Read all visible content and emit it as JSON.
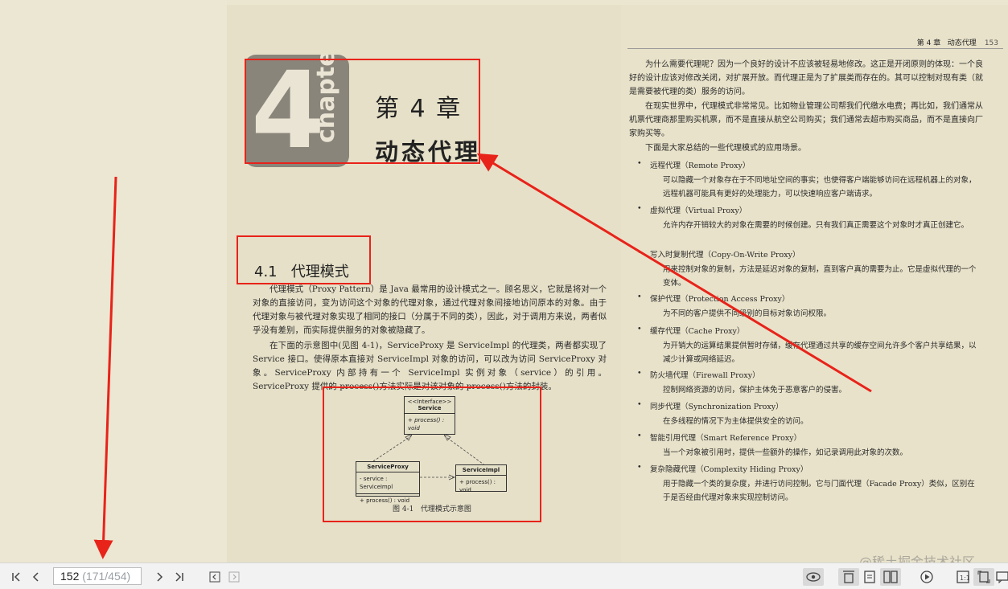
{
  "left_page": {
    "chapter_number": "4",
    "chapter_word": "chapter",
    "chapter_title": "第 4 章",
    "chapter_subtitle": "动态代理",
    "section_title": "4.1   代理模式",
    "paragraphs": [
      "代理模式（Proxy Pattern）是 Java 最常用的设计模式之一。顾名思义，它就是将对一个对象的直接访问，变为访问这个对象的代理对象，通过代理对象间接地访问原本的对象。由于代理对象与被代理对象实现了相同的接口（分属于不同的类），因此，对于调用方来说，两者似乎没有差别，而实际提供服务的对象被隐藏了。",
      "在下面的示意图中(见图 4-1)，ServiceProxy 是 ServiceImpl 的代理类，两者都实现了 Service 接口。使得原本直接对 ServiceImpl 对象的访问，可以改为访问 ServiceProxy 对象。ServiceProxy 内部持有一个 ServiceImpl 实例对象（service）的引用。ServiceProxy 提供的 process()方法实际是对该对象的 process()方法的封装。"
    ],
    "figure": {
      "interface_stereotype": "<<Interface>>",
      "interface_name": "Service",
      "interface_method": "+ process() : void",
      "proxy_name": "ServiceProxy",
      "proxy_field": "- service : ServiceImpl",
      "proxy_method": "+ process() : void",
      "impl_name": "ServiceImpl",
      "impl_method": "+ process() : void",
      "caption": "图 4-1   代理模式示意图"
    }
  },
  "right_page": {
    "running_head": "第 4 章   动态代理",
    "page_number": "153",
    "paragraphs": [
      "为什么需要代理呢？因为一个良好的设计不应该被轻易地修改。这正是开闭原则的体现：一个良好的设计应该对修改关闭，对扩展开放。而代理正是为了扩展类而存在的。其可以控制对现有类（就是需要被代理的类）服务的访问。",
      "在现实世界中，代理模式非常常见。比如物业管理公司帮我们代缴水电费；再比如，我们通常从机票代理商那里购买机票，而不是直接从航空公司购买；我们通常去超市购买商品，而不是直接向厂家购买等。",
      "下面是大家总结的一些代理模式的应用场景。"
    ],
    "items": [
      {
        "title": "远程代理（Remote Proxy）",
        "desc": "可以隐藏一个对象存在于不同地址空间的事实；也使得客户端能够访问在远程机器上的对象，远程机器可能具有更好的处理能力，可以快速响应客户端请求。"
      },
      {
        "title": "虚拟代理（Virtual Proxy）",
        "desc": "允许内存开销较大的对象在需要的时候创建。只有我们真正需要这个对象时才真正创建它。"
      },
      {
        "title": "写入时复制代理（Copy-On-Write Proxy）",
        "desc": "用来控制对象的复制，方法是延迟对象的复制，直到客户真的需要为止。它是虚拟代理的一个变体。"
      },
      {
        "title": "保护代理（Protection Access Proxy）",
        "desc": "为不同的客户提供不同级别的目标对象访问权限。"
      },
      {
        "title": "缓存代理（Cache Proxy）",
        "desc": "为开销大的运算结果提供暂时存储，缓存代理通过共享的缓存空间允许多个客户共享结果，以减少计算或网络延迟。"
      },
      {
        "title": "防火墙代理（Firewall Proxy）",
        "desc": "控制网络资源的访问，保护主体免于恶意客户的侵害。"
      },
      {
        "title": "同步代理（Synchronization Proxy）",
        "desc": "在多线程的情况下为主体提供安全的访问。"
      },
      {
        "title": "智能引用代理（Smart Reference Proxy）",
        "desc": "当一个对象被引用时，提供一些额外的操作，如记录调用此对象的次数。"
      },
      {
        "title": "复杂隐藏代理（Complexity Hiding Proxy）",
        "desc": "用于隐藏一个类的复杂度，并进行访问控制。它与门面代理（Facade Proxy）类似，区别在于是否经由代理对象来实现控制访问。"
      }
    ]
  },
  "toolbar": {
    "current_page": "152",
    "page_total": " (171/454)"
  },
  "watermark": "@稀土掘金技术社区",
  "colors": {
    "annotation": "#e8231a",
    "page_background": "#e6e0c8",
    "toolbar_background": "#f2f2f2"
  }
}
